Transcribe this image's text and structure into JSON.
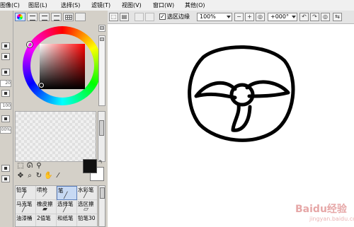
{
  "menubar": {
    "items": [
      "图像",
      "图层",
      "选择",
      "滤镜",
      "视图",
      "窗口",
      "其他"
    ],
    "shortcuts": [
      "(C)",
      "(L)",
      "(S)",
      "(T)",
      "(V)",
      "(W)",
      "(O)"
    ]
  },
  "left_edge": {
    "values": [
      "20",
      "100",
      "00%"
    ]
  },
  "color_panel": {
    "foreground_color": "#111111",
    "background_color": "#ffffff",
    "hue": "#ff0000"
  },
  "tools": {
    "row1": [
      "selection-rect",
      "lasso",
      "magic-wand"
    ],
    "row2": [
      "move",
      "zoom",
      "rotate",
      "hand",
      "eyedropper"
    ]
  },
  "brushes": [
    {
      "label": "铅笔",
      "selected": false
    },
    {
      "label": "喷枪",
      "selected": false
    },
    {
      "label": "笔",
      "selected": true
    },
    {
      "label": "水彩笔",
      "selected": false
    },
    {
      "label": "马克笔",
      "selected": false
    },
    {
      "label": "橡皮擦",
      "selected": false
    },
    {
      "label": "选择笔",
      "selected": false
    },
    {
      "label": "选区擦",
      "selected": false
    },
    {
      "label": "油漆桶",
      "selected": false
    },
    {
      "label": "2值笔",
      "selected": false
    },
    {
      "label": "和纸笔",
      "selected": false
    },
    {
      "label": "铅笔30",
      "selected": false
    }
  ],
  "toolbar": {
    "selection_edge_label": "选区边缘",
    "selection_edge_checked": "✓",
    "zoom_value": "100%",
    "rotation_value": "+000°",
    "zoom_out": "−",
    "zoom_in": "+",
    "zoom_reset": "◎",
    "rot_left": "↶",
    "rot_right": "↷",
    "rot_reset": "◎"
  },
  "watermark": {
    "text": "Baidu经验",
    "sub": "jingyan.baidu.com"
  }
}
